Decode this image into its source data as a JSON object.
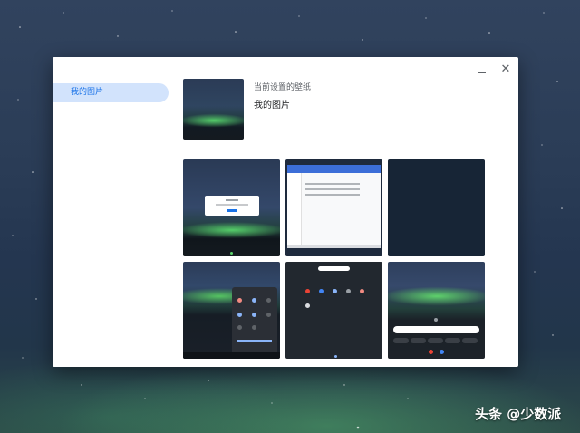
{
  "window": {
    "minimize_icon": "minimize-icon",
    "close_icon": "close-icon",
    "close_glyph": "✕"
  },
  "sidebar": {
    "items": [
      {
        "label": "我的图片",
        "selected": true
      }
    ]
  },
  "current_wallpaper": {
    "label": "当前设置的壁纸",
    "name": "我的图片"
  },
  "wallpapers": [
    {
      "name": "aurora-desktop-dialog"
    },
    {
      "name": "files-app-screenshot"
    },
    {
      "name": "dark-navy-solid"
    },
    {
      "name": "aurora-quick-settings"
    },
    {
      "name": "launcher-apps-dark"
    },
    {
      "name": "aurora-launcher-search"
    }
  ],
  "watermark": "头条 @少数派",
  "colors": {
    "accent": "#1a73e8",
    "selected_bg": "#d2e3fc"
  }
}
